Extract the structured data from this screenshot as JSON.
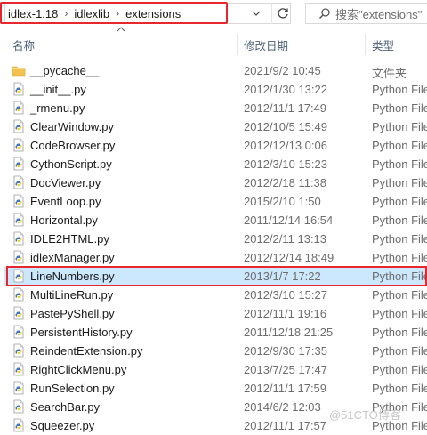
{
  "address_bar": {
    "crumbs": [
      "idlex-1.18",
      "idlexlib",
      "extensions"
    ],
    "separator_glyph": "›"
  },
  "search": {
    "placeholder": "搜索\"extensions\""
  },
  "columns": {
    "name": "名称",
    "date": "修改日期",
    "type": "类型"
  },
  "rows": [
    {
      "name": "__pycache__",
      "date": "2021/9/2 10:45",
      "type": "文件夹",
      "icon": "folder-icon"
    },
    {
      "name": "__init__.py",
      "date": "2012/1/30 13:22",
      "type": "Python File",
      "icon": "python-file-icon"
    },
    {
      "name": "_rmenu.py",
      "date": "2012/11/1 17:49",
      "type": "Python File",
      "icon": "python-file-icon"
    },
    {
      "name": "ClearWindow.py",
      "date": "2012/10/5 15:49",
      "type": "Python File",
      "icon": "python-file-icon"
    },
    {
      "name": "CodeBrowser.py",
      "date": "2012/12/13 0:06",
      "type": "Python File",
      "icon": "python-file-icon"
    },
    {
      "name": "CythonScript.py",
      "date": "2012/3/10 15:23",
      "type": "Python File",
      "icon": "python-file-icon"
    },
    {
      "name": "DocViewer.py",
      "date": "2012/2/18 11:38",
      "type": "Python File",
      "icon": "python-file-icon"
    },
    {
      "name": "EventLoop.py",
      "date": "2015/2/10 1:50",
      "type": "Python File",
      "icon": "python-file-icon"
    },
    {
      "name": "Horizontal.py",
      "date": "2011/12/14 16:54",
      "type": "Python File",
      "icon": "python-file-icon"
    },
    {
      "name": "IDLE2HTML.py",
      "date": "2012/2/11 13:13",
      "type": "Python File",
      "icon": "python-file-icon"
    },
    {
      "name": "idlexManager.py",
      "date": "2012/12/14 18:49",
      "type": "Python File",
      "icon": "python-file-icon"
    },
    {
      "name": "LineNumbers.py",
      "date": "2013/1/7 17:22",
      "type": "Python File",
      "icon": "python-file-icon",
      "selected": true
    },
    {
      "name": "MultiLineRun.py",
      "date": "2012/3/10 15:27",
      "type": "Python File",
      "icon": "python-file-icon"
    },
    {
      "name": "PastePyShell.py",
      "date": "2012/11/1 19:16",
      "type": "Python File",
      "icon": "python-file-icon"
    },
    {
      "name": "PersistentHistory.py",
      "date": "2011/12/18 21:25",
      "type": "Python File",
      "icon": "python-file-icon"
    },
    {
      "name": "ReindentExtension.py",
      "date": "2012/9/30 17:35",
      "type": "Python File",
      "icon": "python-file-icon"
    },
    {
      "name": "RightClickMenu.py",
      "date": "2013/7/25 17:47",
      "type": "Python File",
      "icon": "python-file-icon"
    },
    {
      "name": "RunSelection.py",
      "date": "2012/11/1 17:59",
      "type": "Python File",
      "icon": "python-file-icon"
    },
    {
      "name": "SearchBar.py",
      "date": "2014/6/2 12:03",
      "type": "Python File",
      "icon": "python-file-icon"
    },
    {
      "name": "Squeezer.py",
      "date": "2012/11/1 17:57",
      "type": "Python File",
      "icon": "python-file-icon"
    }
  ],
  "watermark": "@51CTO博客",
  "colors": {
    "highlight": "#e8262d",
    "selection": "#cce8ff",
    "folder": "#f2c14e"
  }
}
